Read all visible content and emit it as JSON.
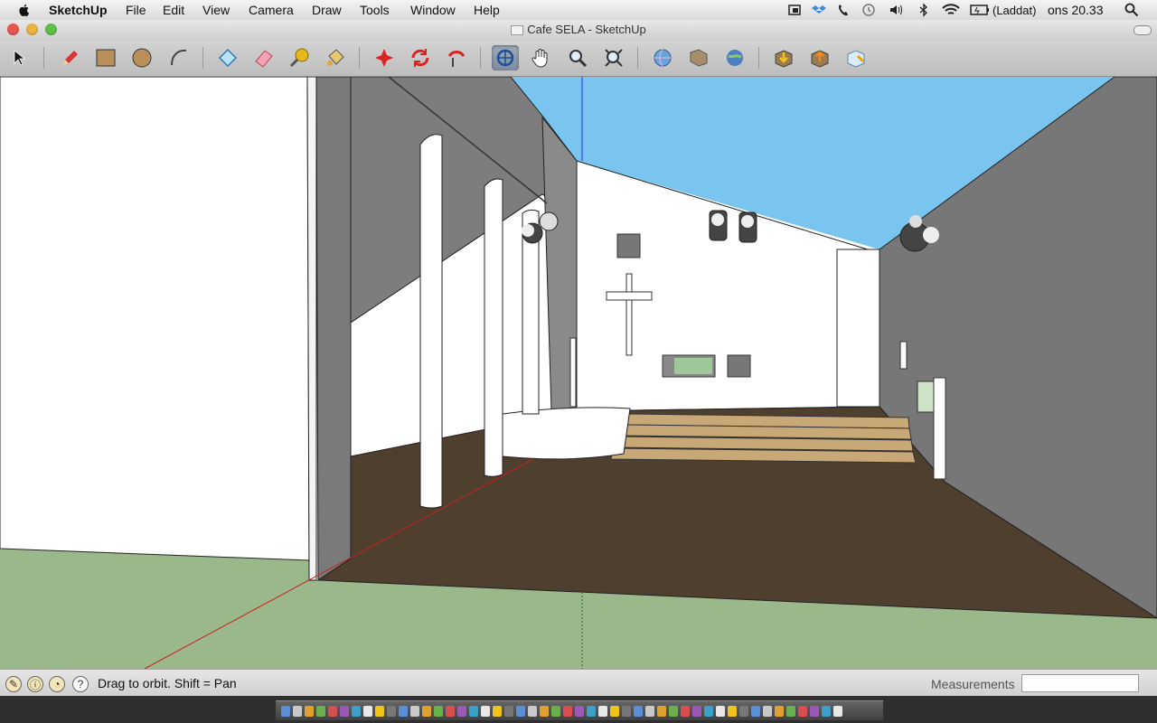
{
  "menubar": {
    "app_name": "SketchUp",
    "menus": [
      "File",
      "Edit",
      "View",
      "Camera",
      "Draw",
      "Tools",
      "Window",
      "Help"
    ],
    "battery_status": "(Laddat)",
    "clock": "ons 20.33"
  },
  "window": {
    "title": "Cafe SELA - SketchUp"
  },
  "toolbar": {
    "tools": [
      "select-icon",
      "pencil-icon",
      "rectangle-icon",
      "circle-icon",
      "arc-icon",
      "make-component-icon",
      "eraser-icon",
      "tape-measure-icon",
      "paint-bucket-icon",
      "push-pull-icon",
      "rotate-icon",
      "follow-me-icon",
      "orbit-icon",
      "pan-icon",
      "zoom-icon",
      "zoom-extents-icon",
      "3d-warehouse-icon",
      "share-model-icon",
      "google-earth-icon",
      "get-models-icon",
      "share-component-icon",
      "extension-icon"
    ]
  },
  "statusbar": {
    "status_text": "Drag to orbit.  Shift = Pan",
    "measurements_label": "Measurements",
    "measurements_value": ""
  },
  "colors": {
    "sky": "#7ac4f0",
    "floor": "#4f3f2e",
    "ground": "#9ab88a",
    "stairs": "#c9a878",
    "wall_gray": "#7a7a7a"
  }
}
